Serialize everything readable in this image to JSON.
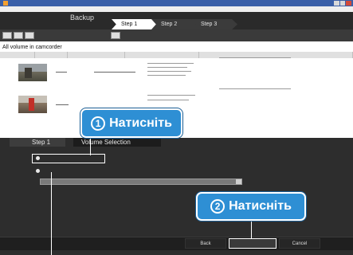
{
  "window": {
    "title": "",
    "menu_text": ""
  },
  "steps": {
    "backup": "Backup",
    "step1": "Step 1",
    "step2": "Step 2",
    "step3": "Step 3"
  },
  "list": {
    "section_title": "All volume in camcorder",
    "columns": [
      "",
      "",
      "",
      "",
      ""
    ],
    "rows": [
      {
        "name": "",
        "date": "",
        "info": ""
      },
      {
        "name": "",
        "date": "",
        "info": ""
      }
    ]
  },
  "panel": {
    "tab_step": "Step 1",
    "tab_title": "Volume Selection",
    "option_all": "",
    "option_select": "",
    "dropdown_value": ""
  },
  "footer": {
    "back": "Back",
    "next": "",
    "cancel": "Cancel"
  },
  "callouts": [
    {
      "number": "1",
      "label": "Натисніть"
    },
    {
      "number": "2",
      "label": "Натисніть"
    }
  ],
  "colors": {
    "callout": "#2e8fd4",
    "titlebar": "#3a5fa8",
    "panel": "#2d2d2d"
  }
}
